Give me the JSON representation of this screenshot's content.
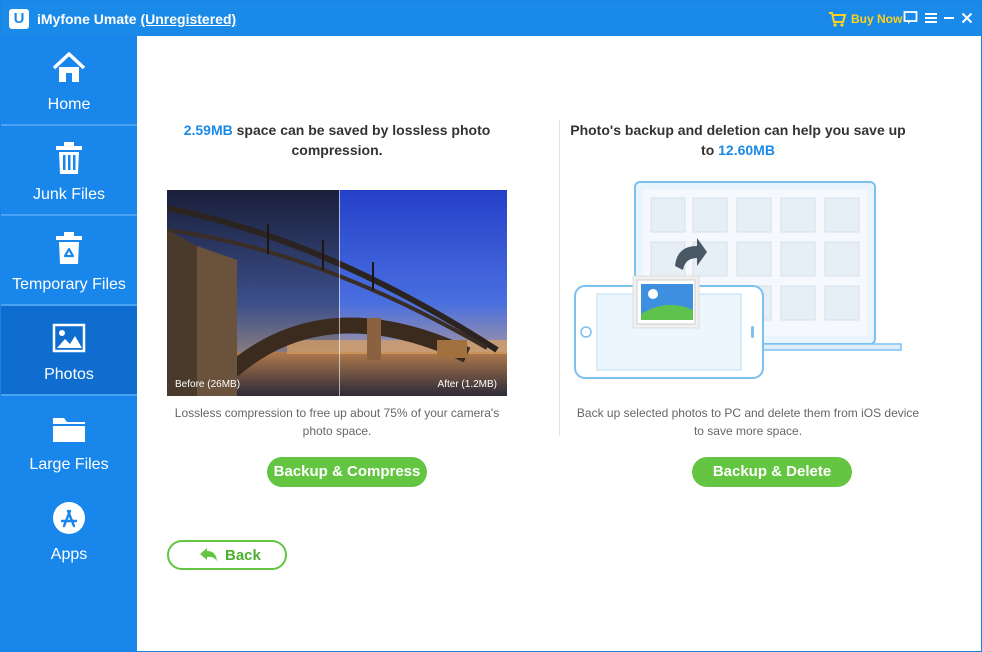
{
  "titlebar": {
    "logo_letter": "U",
    "app_name": "iMyfone Umate",
    "registration": "(Unregistered)",
    "buy_now": "Buy Now"
  },
  "sidebar": {
    "items": [
      {
        "label": "Home",
        "icon": "home-icon"
      },
      {
        "label": "Junk Files",
        "icon": "trash-icon"
      },
      {
        "label": "Temporary Files",
        "icon": "recycle-bin-icon"
      },
      {
        "label": "Photos",
        "icon": "photo-icon",
        "active": true
      },
      {
        "label": "Large Files",
        "icon": "folder-icon"
      },
      {
        "label": "Apps",
        "icon": "app-store-icon"
      }
    ]
  },
  "left_panel": {
    "headline_amount": "2.59MB",
    "headline_rest_1": " space can be saved by lossless photo",
    "headline_line2": "compression.",
    "before_caption": "Before (26MB)",
    "after_caption": "After (1.2MB)",
    "description_line1": "Lossless compression to free up about 75% of your camera's",
    "description_line2": "photo space.",
    "button_label": "Backup & Compress"
  },
  "right_panel": {
    "headline_line1": "Photo's backup and deletion can help you save up",
    "headline_prefix2": "to ",
    "headline_amount": "12.60MB",
    "description_line1": "Back up selected photos to PC and delete them from iOS device",
    "description_line2": "to save more space.",
    "button_label": "Backup & Delete"
  },
  "back_button": {
    "label": "Back"
  },
  "colors": {
    "brand_blue": "#1a8ae8",
    "sidebar_active": "#0f6dd0",
    "accent_green": "#63c542",
    "buy_now_yellow": "#ffd21f"
  }
}
